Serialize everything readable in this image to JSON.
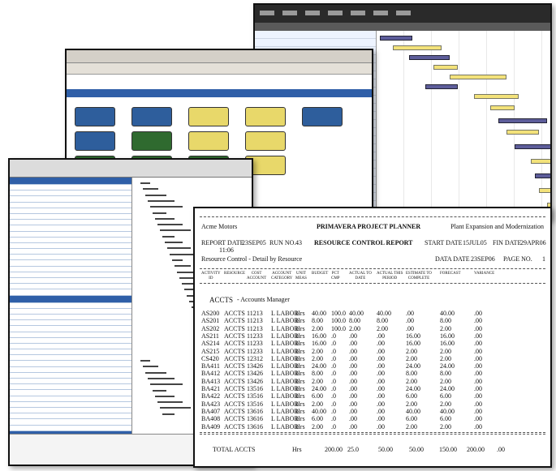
{
  "report": {
    "company": "Acme Motors",
    "product": "PRIMAVERA PROJECT PLANNER",
    "project": "Plant Expansion and Modernization",
    "report_date_label": "REPORT DATE",
    "report_date": "23SEP05",
    "run_label": "RUN NO.",
    "run_no": "43",
    "report_type": "RESOURCE CONTROL REPORT",
    "start_date_label": "START DATE",
    "start_date": "15JUL05",
    "fin_label": "FIN DATE",
    "fin_date": "29APR06",
    "time": "11:06",
    "subtitle": "Resource Control - Detail by Resource",
    "data_date_label": "DATA DATE",
    "data_date": "23SEP06",
    "page_label": "PAGE NO.",
    "page_no": "1",
    "columns": [
      "ACTIVITY ID",
      "RESOURCE",
      "COST ACCOUNT",
      "ACCOUNT CATEGORY",
      "UNIT MEAS",
      "BUDGET",
      "PCT CMP",
      "ACTUAL TO DATE",
      "ACTUAL THIS PERIOD",
      "ESTIMATE TO COMPLETE",
      "FORECAST",
      "VARIANCE"
    ],
    "group_resource": "ACCTS",
    "group_name": "- Accounts Manager",
    "rows": [
      [
        "AS200",
        "ACCTS",
        "11213",
        "L LABOR",
        "Hrs",
        "40.00",
        "100.0",
        "40.00",
        "40.00",
        ".00",
        "40.00",
        ".00"
      ],
      [
        "AS201",
        "ACCTS",
        "11213",
        "L LABOR",
        "Hrs",
        "8.00",
        "100.0",
        "8.00",
        "8.00",
        ".00",
        "8.00",
        ".00"
      ],
      [
        "AS202",
        "ACCTS",
        "11213",
        "L LABOR",
        "Hrs",
        "2.00",
        "100.0",
        "2.00",
        "2.00",
        ".00",
        "2.00",
        ".00"
      ],
      [
        "AS211",
        "ACCTS",
        "11233",
        "L LABOR",
        "Hrs",
        "16.00",
        ".0",
        ".00",
        ".00",
        "16.00",
        "16.00",
        ".00"
      ],
      [
        "AS214",
        "ACCTS",
        "11233",
        "L LABOR",
        "Hrs",
        "16.00",
        ".0",
        ".00",
        ".00",
        "16.00",
        "16.00",
        ".00"
      ],
      [
        "AS215",
        "ACCTS",
        "11233",
        "L LABOR",
        "Hrs",
        "2.00",
        ".0",
        ".00",
        ".00",
        "2.00",
        "2.00",
        ".00"
      ],
      [
        "CS420",
        "ACCTS",
        "12312",
        "L LABOR",
        "Hrs",
        "2.00",
        ".0",
        ".00",
        ".00",
        "2.00",
        "2.00",
        ".00"
      ],
      [
        "BA411",
        "ACCTS",
        "13426",
        "L LABOR",
        "Hrs",
        "24.00",
        ".0",
        ".00",
        ".00",
        "24.00",
        "24.00",
        ".00"
      ],
      [
        "BA412",
        "ACCTS",
        "13426",
        "L LABOR",
        "Hrs",
        "8.00",
        ".0",
        ".00",
        ".00",
        "8.00",
        "8.00",
        ".00"
      ],
      [
        "BA413",
        "ACCTS",
        "13426",
        "L LABOR",
        "Hrs",
        "2.00",
        ".0",
        ".00",
        ".00",
        "2.00",
        "2.00",
        ".00"
      ],
      [
        "BA421",
        "ACCTS",
        "13516",
        "L LABOR",
        "Hrs",
        "24.00",
        ".0",
        ".00",
        ".00",
        "24.00",
        "24.00",
        ".00"
      ],
      [
        "BA422",
        "ACCTS",
        "13516",
        "L LABOR",
        "Hrs",
        "6.00",
        ".0",
        ".00",
        ".00",
        "6.00",
        "6.00",
        ".00"
      ],
      [
        "BA423",
        "ACCTS",
        "13516",
        "L LABOR",
        "Hrs",
        "2.00",
        ".0",
        ".00",
        ".00",
        "2.00",
        "2.00",
        ".00"
      ],
      [
        "BA407",
        "ACCTS",
        "13616",
        "L LABOR",
        "Hrs",
        "40.00",
        ".0",
        ".00",
        ".00",
        "40.00",
        "40.00",
        ".00"
      ],
      [
        "BA408",
        "ACCTS",
        "13616",
        "L LABOR",
        "Hrs",
        "6.00",
        ".0",
        ".00",
        ".00",
        "6.00",
        "6.00",
        ".00"
      ],
      [
        "BA409",
        "ACCTS",
        "13616",
        "L LABOR",
        "Hrs",
        "2.00",
        ".0",
        ".00",
        ".00",
        "2.00",
        "2.00",
        ".00"
      ]
    ],
    "total_label": "TOTAL ACCTS",
    "total_unit": "Hrs",
    "total_budget": "200.00",
    "total_pct": "25.0",
    "total_actual": "50.00",
    "total_period": "50.00",
    "total_etc": "150.00",
    "total_forecast": "200.00",
    "total_variance": ".00"
  },
  "colors": {
    "band_blue": "#2f5fa8",
    "gantt_yellow": "#f3e27a",
    "node_green": "#2f6a2f"
  }
}
